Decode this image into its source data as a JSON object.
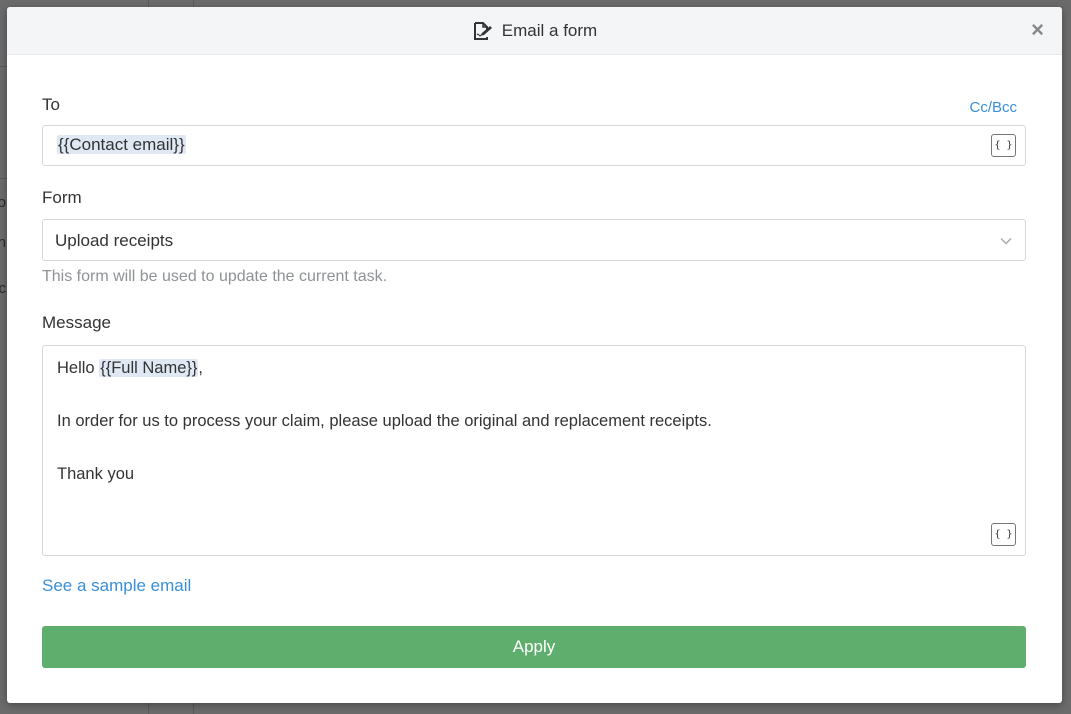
{
  "background": {
    "fragments": [
      "o",
      "n",
      "c"
    ]
  },
  "dialog": {
    "title": "Email a form",
    "icon": "form-edit-icon",
    "close_label": "×"
  },
  "to": {
    "label": "To",
    "cc_bcc_link": "Cc/Bcc",
    "value": "{{Contact email}}",
    "variable_button": "{ }"
  },
  "form": {
    "label": "Form",
    "selected": "Upload receipts",
    "help_text": "This form will be used to update the current task."
  },
  "message": {
    "label": "Message",
    "greeting_prefix": "Hello ",
    "greeting_token": "{{Full Name}}",
    "greeting_suffix": ",",
    "body": "In order for us to process your claim, please upload the original and replacement receipts.",
    "closing": "Thank you",
    "variable_button": "{ }"
  },
  "sample_link": "See a sample email",
  "apply_label": "Apply",
  "colors": {
    "accent": "#3a8fd8",
    "apply": "#5fae6e",
    "token_highlight": "#dfe8f3",
    "help_text": "#8f9295"
  }
}
